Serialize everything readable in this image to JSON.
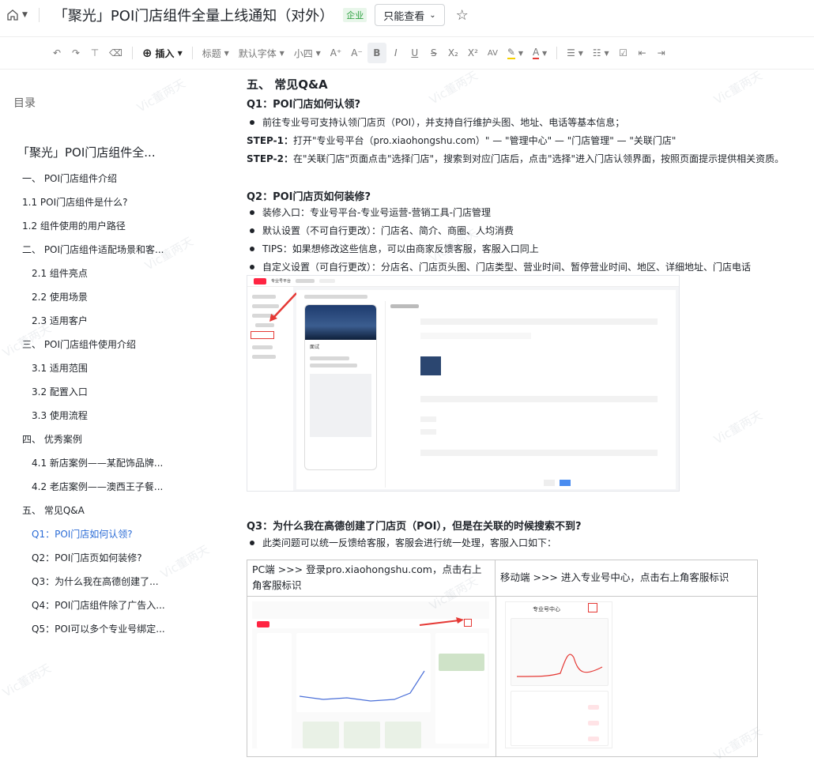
{
  "titlebar": {
    "title": "「聚光」POI门店组件全量上线通知（对外）",
    "badge": "企业",
    "view_mode": "只能查看"
  },
  "toolbar": {
    "insert": "插入",
    "heading": "标题",
    "font": "默认字体",
    "size": "小四",
    "bold": "B",
    "italic": "I",
    "underline": "U",
    "strike": "S",
    "subscript": "X₂",
    "superscript": "X²",
    "spacing": "AV"
  },
  "sidebar": {
    "heading": "目录",
    "root": "「聚光」POI门店组件全...",
    "items": [
      {
        "label": "一、 POI门店组件介绍",
        "level": 1
      },
      {
        "label": "1.1  POI门店组件是什么?",
        "level": 2
      },
      {
        "label": "1.2  组件使用的用户路径",
        "level": 2
      },
      {
        "label": "二、 POI门店组件适配场景和客...",
        "level": 1
      },
      {
        "label": "2.1  组件亮点",
        "level": 3
      },
      {
        "label": "2.2  使用场景",
        "level": 3
      },
      {
        "label": "2.3  适用客户",
        "level": 3
      },
      {
        "label": "三、 POI门店组件使用介绍",
        "level": 1
      },
      {
        "label": "3.1  适用范围",
        "level": 3
      },
      {
        "label": "3.2  配置入口",
        "level": 3
      },
      {
        "label": "3.3  使用流程",
        "level": 3
      },
      {
        "label": "四、 优秀案例",
        "level": 1
      },
      {
        "label": "4.1  新店案例——某配饰品牌...",
        "level": 3
      },
      {
        "label": "4.2  老店案例——澳西王子餐...",
        "level": 3
      },
      {
        "label": "五、 常见Q&A",
        "level": 1
      },
      {
        "label": "Q1：POI门店如何认领?",
        "level": 3,
        "active": true
      },
      {
        "label": "Q2：POI门店页如何装修?",
        "level": 3
      },
      {
        "label": "Q3：为什么我在高德创建了...",
        "level": 3
      },
      {
        "label": "Q4：POI门店组件除了广告入...",
        "level": 3
      },
      {
        "label": "Q5：POI可以多个专业号绑定...",
        "level": 3
      }
    ]
  },
  "content": {
    "section": "五、 常见Q&A",
    "q1": {
      "title": "Q1：POI门店如何认领?",
      "bullet": "前往专业号可支持认领门店页（POI），并支持自行维护头图、地址、电话等基本信息；",
      "step1_label": "STEP-1：",
      "step1": "打开\"专业号平台（pro.xiaohongshu.com）\" — \"管理中心\" — \"门店管理\" — \"关联门店\"",
      "step2_label": "STEP-2：",
      "step2": "在\"关联门店\"页面点击\"选择门店\"，搜索到对应门店后，点击\"选择\"进入门店认领界面，按照页面提示提供相关资质。"
    },
    "q2": {
      "title": "Q2：POI门店页如何装修?",
      "bullets": [
        "装修入口：专业号平台-专业号运营-营销工具-门店管理",
        "默认设置（不可自行更改）：门店名、简介、商圈、人均消费",
        "TIPS：如果想修改这些信息，可以由商家反馈客服，客服入口同上",
        "自定义设置（可自行更改）：分店名、门店页头图、门店类型、营业时间、暂停营业时间、地区、详细地址、门店电话"
      ]
    },
    "q3": {
      "title": "Q3：为什么我在高德创建了门店页（POI），但是在关联的时候搜索不到?",
      "bullet": "此类问题可以统一反馈给客服，客服会进行统一处理，客服入口如下："
    },
    "table": {
      "pc": "PC端 >>> 登录pro.xiaohongshu.com，点击右上角客服标识",
      "mobile": "移动端 >>> 进入专业号中心，点击右上角客服标识"
    },
    "screenshot1": {
      "platform": "专业号平台",
      "store": "面试"
    },
    "screenshot_mobile": {
      "title": "专业号中心"
    }
  },
  "watermark": "Vic董两天"
}
